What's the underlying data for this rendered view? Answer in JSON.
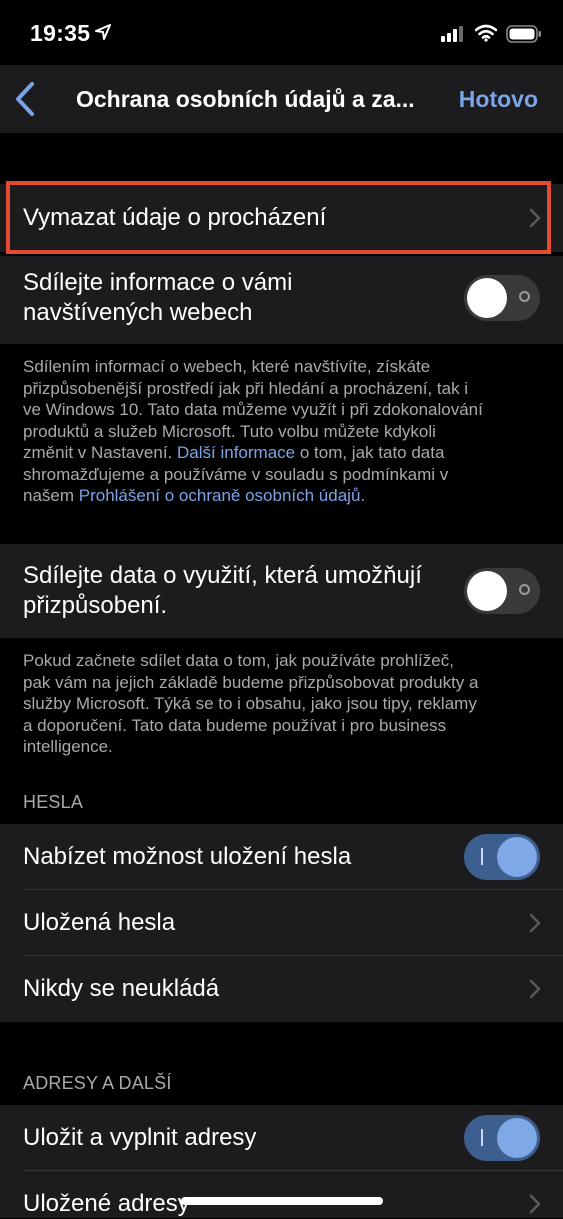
{
  "status_bar": {
    "time": "19:35",
    "icons": [
      "location-arrow-icon",
      "cellular-signal-icon",
      "wifi-icon",
      "battery-icon"
    ]
  },
  "nav": {
    "title": "Ochrana osobních údajů a za...",
    "done": "Hotovo",
    "back_icon": "chevron-left-icon"
  },
  "rows": {
    "clear_data": "Vymazat údaje o procházení",
    "share_sites_line1": "Sdílejte informace o vámi",
    "share_sites_line2": "navštívených webech",
    "share_usage_line1": "Sdílejte data o využití, která umožňují",
    "share_usage_line2": "přizpůsobení."
  },
  "toggles": {
    "share_sites": "off",
    "share_usage": "off",
    "offer_save_password": "on",
    "save_addresses": "on"
  },
  "footers": {
    "share_sites": {
      "lines": [
        "Sdílením informací o webech, které navštívíte, získáte",
        "přizpůsobenější prostředí jak při hledání a procházení, tak i",
        "ve Windows 10. Tato data můžeme využít i při zdokonalování",
        "produktů a služeb Microsoft. Tuto volbu můžete kdykoli",
        "změnit v Nastavení."
      ],
      "link1": "Další informace",
      "after_link1": " o tom, jak tato data",
      "line6": "shromažďujeme a používáme v souladu s podmínkami v",
      "line7_prefix": "našem ",
      "link2": "Prohlášení o ochraně osobních údajů",
      "line7_suffix": "."
    },
    "share_usage": {
      "lines": [
        "Pokud začnete sdílet data o tom, jak používáte prohlížeč,",
        "pak vám na jejich základě budeme přizpůsobovat produkty a",
        "služby Microsoft. Týká se to i obsahu, jako jsou tipy, reklamy",
        "a doporučení. Tato data budeme používat i pro business",
        "intelligence."
      ]
    }
  },
  "sections": {
    "passwords": {
      "header": "HESLA",
      "offer_save": "Nabízet možnost uložení hesla",
      "saved": "Uložená hesla",
      "never_saved": "Nikdy se neukládá"
    },
    "addresses": {
      "header": "ADRESY A DALŠÍ",
      "save_fill": "Uložit a vyplnit adresy",
      "saved": "Uložené adresy"
    }
  },
  "colors": {
    "accent": "#7ba3e6",
    "highlight": "#e34a33",
    "cell_background": "#1c1c1e",
    "background": "#000000"
  }
}
